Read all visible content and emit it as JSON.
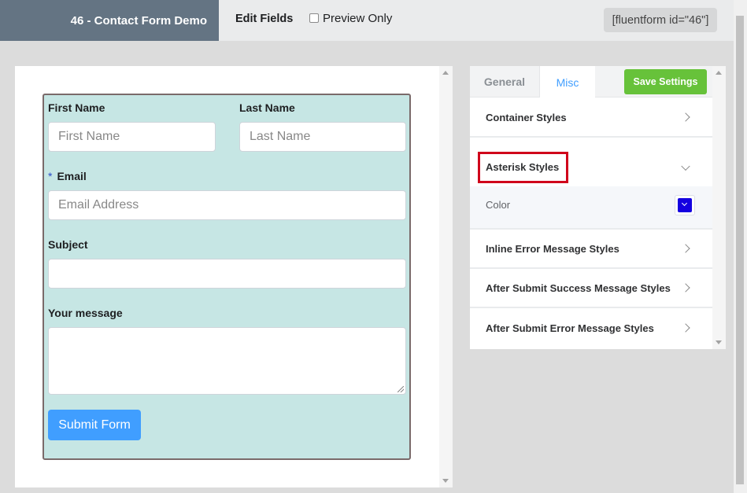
{
  "topbar": {
    "form_title": "46 - Contact Form Demo",
    "edit_fields": "Edit Fields",
    "preview_only": "Preview Only",
    "shortcode": "[fluentform id=\"46\"]"
  },
  "form": {
    "first_name_label": "First Name",
    "first_name_placeholder": "First Name",
    "last_name_label": "Last Name",
    "last_name_placeholder": "Last Name",
    "email_required_mark": "*",
    "email_label": "Email",
    "email_placeholder": "Email Address",
    "subject_label": "Subject",
    "subject_value": "",
    "message_label": "Your message",
    "submit_label": "Submit Form",
    "background_color": "#c6e6e4"
  },
  "settings": {
    "tabs": [
      {
        "label": "General",
        "active": false
      },
      {
        "label": "Misc",
        "active": true
      }
    ],
    "save_label": "Save Settings",
    "sections": [
      {
        "label": "Container Styles",
        "expanded": false
      },
      {
        "label": "Asterisk Styles",
        "expanded": true
      },
      {
        "label": "Inline Error Message Styles",
        "expanded": false
      },
      {
        "label": "After Submit Success Message Styles",
        "expanded": false
      },
      {
        "label": "After Submit Error Message Styles",
        "expanded": false
      }
    ],
    "asterisk_color_label": "Color",
    "asterisk_color_value": "#1400e0"
  },
  "colors": {
    "accent": "#409eff",
    "save_button": "#67c23a",
    "highlight": "#d0021b"
  }
}
